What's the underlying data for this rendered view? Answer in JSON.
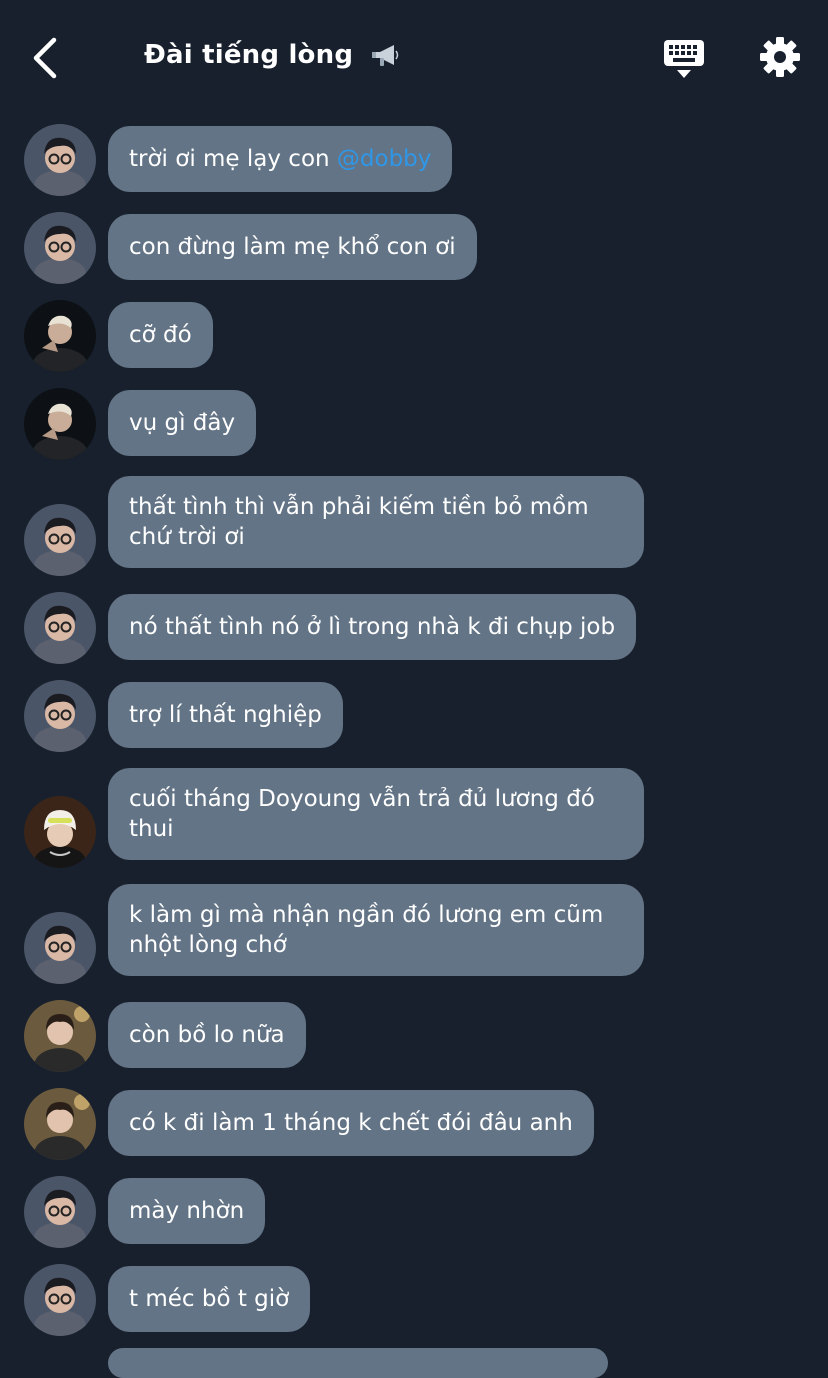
{
  "header": {
    "title": "Đài tiếng lòng",
    "back_icon": "chevron-left-icon",
    "title_icon": "megaphone-icon",
    "keyboard_icon": "keyboard-hide-icon",
    "settings_icon": "gear-icon"
  },
  "colors": {
    "background": "#17202c",
    "bubble": "#637486",
    "mention": "#2f97e8",
    "text": "#ffffff"
  },
  "messages": [
    {
      "avatar": "glasses-boy",
      "text": "trời ơi mẹ lạy con ",
      "mention": "@dobby"
    },
    {
      "avatar": "glasses-boy",
      "text": "con đừng làm mẹ khổ con ơi"
    },
    {
      "avatar": "dark-blond",
      "text": "cỡ đó"
    },
    {
      "avatar": "dark-blond",
      "text": "vụ gì đây"
    },
    {
      "avatar": "glasses-boy",
      "text": "thất tình thì vẫn phải kiếm tiền bỏ mồm chứ trời ơi"
    },
    {
      "avatar": "glasses-boy",
      "text": "nó thất tình nó ở lì trong nhà k đi chụp job"
    },
    {
      "avatar": "glasses-boy",
      "text": "trợ lí thất nghiệp"
    },
    {
      "avatar": "beanie-boy",
      "text": "cuối tháng Doyoung vẫn trả đủ lương đó thui"
    },
    {
      "avatar": "glasses-boy",
      "text": "k làm gì mà nhận ngần đó lương em cũm nhột lòng chớ"
    },
    {
      "avatar": "coat-boy",
      "text": "còn bồ lo nữa"
    },
    {
      "avatar": "coat-boy",
      "text": "có k đi làm 1 tháng k chết đói đâu anh"
    },
    {
      "avatar": "glasses-boy",
      "text": "mày nhờn"
    },
    {
      "avatar": "glasses-boy",
      "text": "t méc bồ t giờ"
    }
  ]
}
